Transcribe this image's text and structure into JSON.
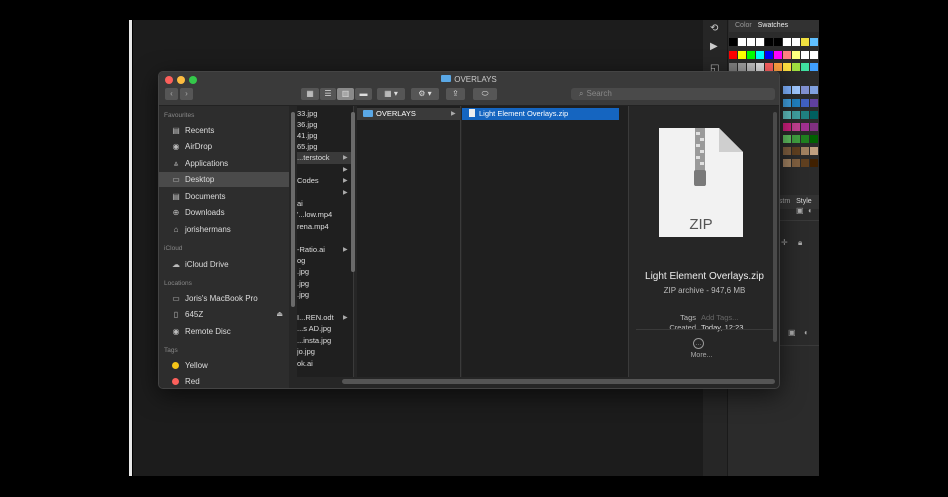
{
  "window": {
    "title": "OVERLAYS",
    "search_placeholder": "Search"
  },
  "sidebar": {
    "favourites_label": "Favourites",
    "favourites": [
      "Recents",
      "AirDrop",
      "Applications",
      "Desktop",
      "Documents",
      "Downloads",
      "jorishermans"
    ],
    "icloud_label": "iCloud",
    "icloud": [
      "iCloud Drive"
    ],
    "locations_label": "Locations",
    "locations": [
      "Joris's MacBook Pro",
      "645Z",
      "Remote Disc"
    ],
    "tags_label": "Tags",
    "tags": [
      "Yellow",
      "Red"
    ]
  },
  "column1": [
    "33.jpg",
    "36.jpg",
    "41.jpg",
    "65.jpg",
    "...terstock",
    "",
    "Codes",
    "",
    "ai",
    "'...low.mp4",
    "rena.mp4",
    "",
    "-Ratio.ai",
    "og",
    ".jpg",
    ".jpg",
    ".jpg",
    "",
    "I...REN.odt",
    "...s AD.jpg",
    "...insta.jpg",
    "jo.jpg",
    "ok.ai"
  ],
  "column2": [
    "OVERLAYS"
  ],
  "column3": [
    "Light Element Overlays.zip"
  ],
  "preview": {
    "icon_label": "ZIP",
    "name": "Light Element Overlays.zip",
    "info": "ZIP archive - 947,6 MB",
    "tags_label": "Tags",
    "tags_value": "Add Tags...",
    "created_label": "Created",
    "created_value": "Today, 12:23",
    "more_label": "More..."
  },
  "photoshop": {
    "tab_color": "Color",
    "tab_swatches": "Swatches",
    "sub_tab1": "ustm",
    "sub_tab2": "Style"
  }
}
